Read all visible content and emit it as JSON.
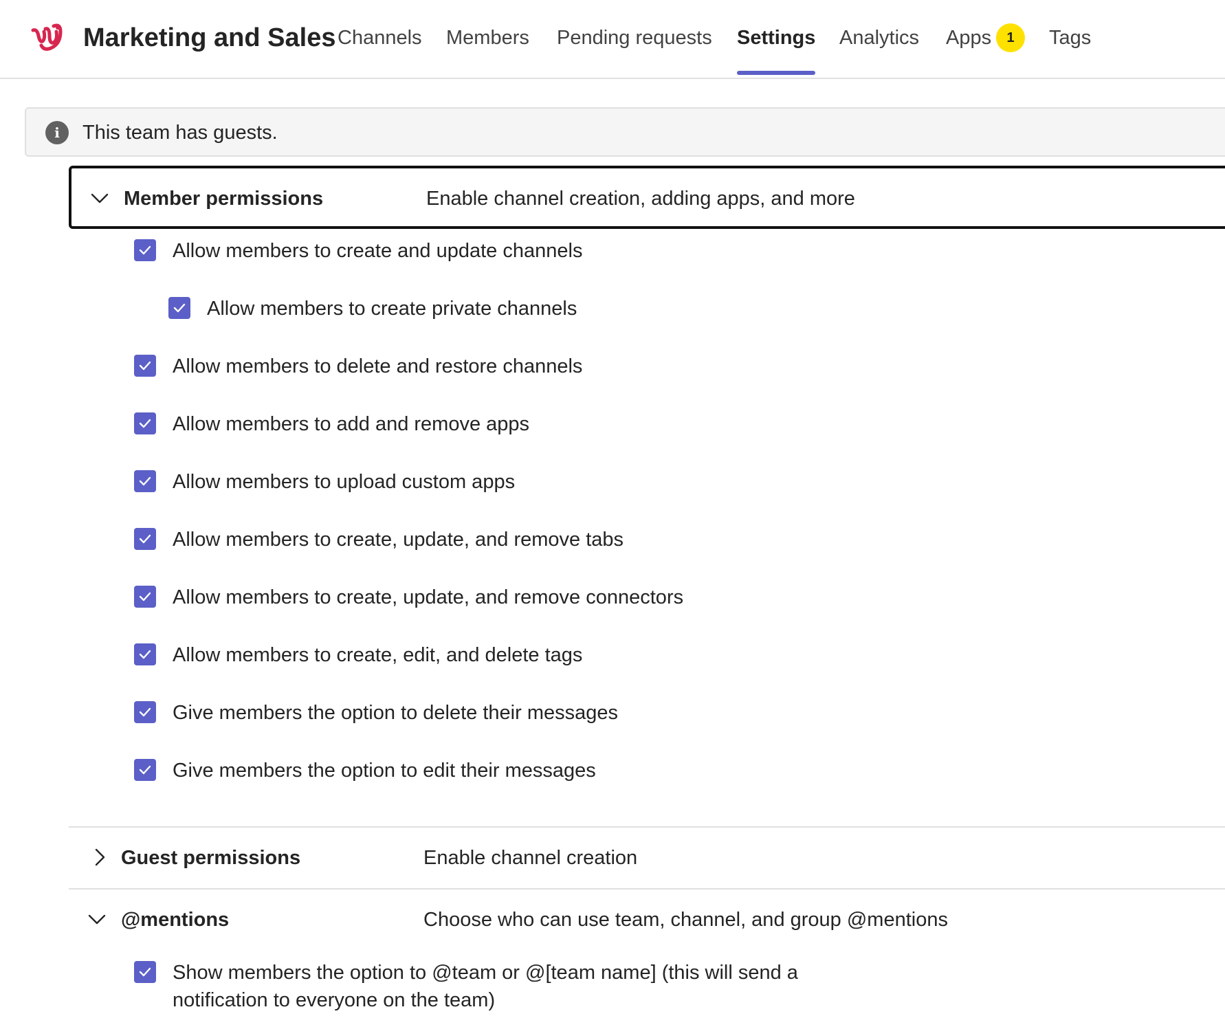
{
  "header": {
    "team_name": "Marketing and Sales",
    "tabs": [
      {
        "label": "Channels"
      },
      {
        "label": "Members"
      },
      {
        "label": "Pending requests"
      },
      {
        "label": "Settings",
        "active": true
      },
      {
        "label": "Analytics"
      },
      {
        "label": "Apps",
        "badge": "1"
      },
      {
        "label": "Tags"
      }
    ],
    "accent_color": "#5b5fc7",
    "badge_color": "#ffe100"
  },
  "banner": {
    "icon": "info-icon",
    "text": "This team has guests."
  },
  "sections": {
    "member_permissions": {
      "title": "Member permissions",
      "description": "Enable channel creation, adding apps, and more",
      "expanded": true,
      "options": [
        {
          "label": "Allow members to create and update channels",
          "checked": true
        },
        {
          "label": "Allow members to create private channels",
          "checked": true,
          "nested": true
        },
        {
          "label": "Allow members to delete and restore channels",
          "checked": true
        },
        {
          "label": "Allow members to add and remove apps",
          "checked": true
        },
        {
          "label": "Allow members to upload custom apps",
          "checked": true
        },
        {
          "label": "Allow members to create, update, and remove tabs",
          "checked": true
        },
        {
          "label": "Allow members to create, update, and remove connectors",
          "checked": true
        },
        {
          "label": "Allow members to create, edit, and delete tags",
          "checked": true
        },
        {
          "label": "Give members the option to delete their messages",
          "checked": true
        },
        {
          "label": "Give members the option to edit their messages",
          "checked": true
        }
      ]
    },
    "guest_permissions": {
      "title": "Guest permissions",
      "description": "Enable channel creation",
      "expanded": false
    },
    "mentions": {
      "title": "@mentions",
      "description": "Choose who can use team, channel, and group @mentions",
      "expanded": true,
      "options": [
        {
          "label_line1": "Show members the option to @team or @[team name] (this will send a",
          "label_line2": "notification to everyone on the team)",
          "checked": true
        }
      ]
    }
  }
}
